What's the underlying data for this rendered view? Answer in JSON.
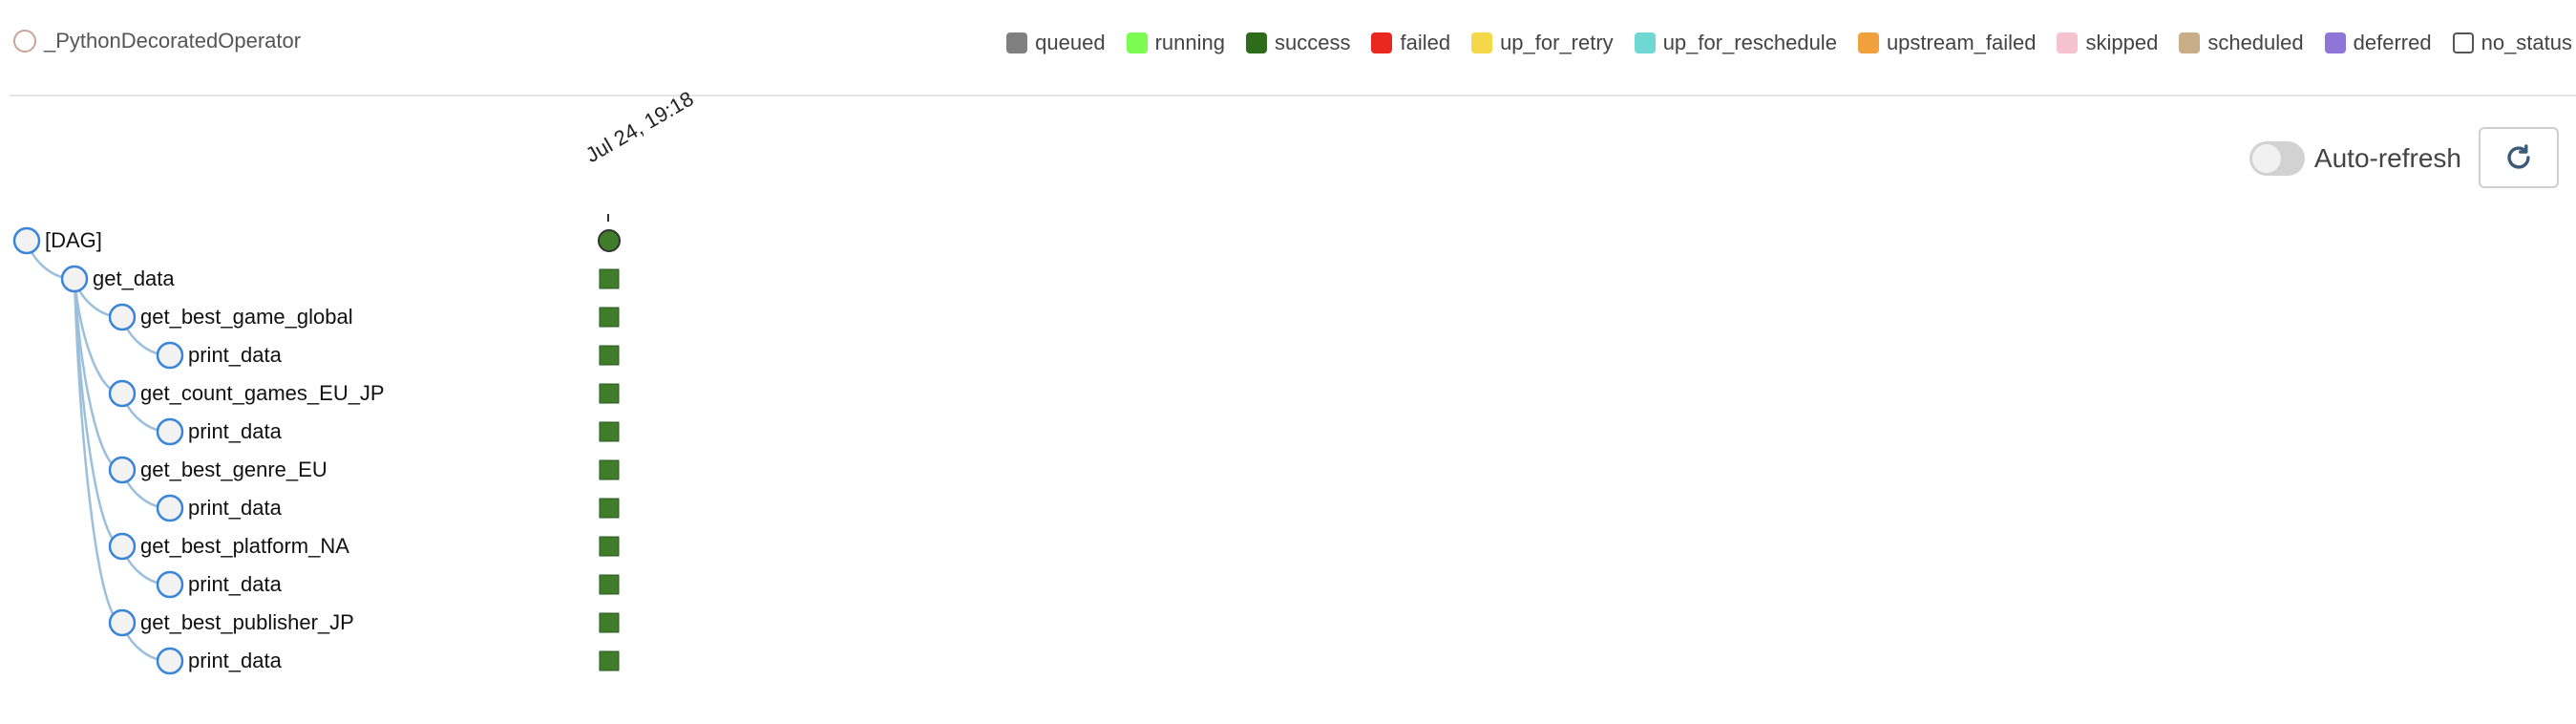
{
  "operator_legend": {
    "label": "_PythonDecoratedOperator",
    "color": "#c8a49a"
  },
  "state_legend": [
    {
      "label": "queued",
      "color": "#808080"
    },
    {
      "label": "running",
      "color": "#7cfc50"
    },
    {
      "label": "success",
      "color": "#2e6b1a"
    },
    {
      "label": "failed",
      "color": "#e8281e"
    },
    {
      "label": "up_for_retry",
      "color": "#f5d74a"
    },
    {
      "label": "up_for_reschedule",
      "color": "#6fd8d2"
    },
    {
      "label": "upstream_failed",
      "color": "#f0a03c"
    },
    {
      "label": "skipped",
      "color": "#f5c2cf"
    },
    {
      "label": "scheduled",
      "color": "#c9ad88"
    },
    {
      "label": "deferred",
      "color": "#9075d8"
    },
    {
      "label": "no_status",
      "color": "#ffffff"
    }
  ],
  "toolbar": {
    "auto_refresh_label": "Auto-refresh",
    "auto_refresh_on": false
  },
  "run": {
    "date_label": "Jul 24, 19:18",
    "state": "success"
  },
  "tree": [
    {
      "label": "[DAG]",
      "depth": 0,
      "parent": null,
      "state": "success"
    },
    {
      "label": "get_data",
      "depth": 1,
      "parent": 0,
      "state": "success"
    },
    {
      "label": "get_best_game_global",
      "depth": 2,
      "parent": 1,
      "state": "success"
    },
    {
      "label": "print_data",
      "depth": 3,
      "parent": 2,
      "state": "success"
    },
    {
      "label": "get_count_games_EU_JP",
      "depth": 2,
      "parent": 1,
      "state": "success"
    },
    {
      "label": "print_data",
      "depth": 3,
      "parent": 4,
      "state": "success"
    },
    {
      "label": "get_best_genre_EU",
      "depth": 2,
      "parent": 1,
      "state": "success"
    },
    {
      "label": "print_data",
      "depth": 3,
      "parent": 6,
      "state": "success"
    },
    {
      "label": "get_best_platform_NA",
      "depth": 2,
      "parent": 1,
      "state": "success"
    },
    {
      "label": "print_data",
      "depth": 3,
      "parent": 8,
      "state": "success"
    },
    {
      "label": "get_best_publisher_JP",
      "depth": 2,
      "parent": 1,
      "state": "success"
    },
    {
      "label": "print_data",
      "depth": 3,
      "parent": 10,
      "state": "success"
    }
  ],
  "colors": {
    "node_stroke": "#3a85d8",
    "link_stroke": "#9cbfdc",
    "success": "#3f7d2a"
  }
}
